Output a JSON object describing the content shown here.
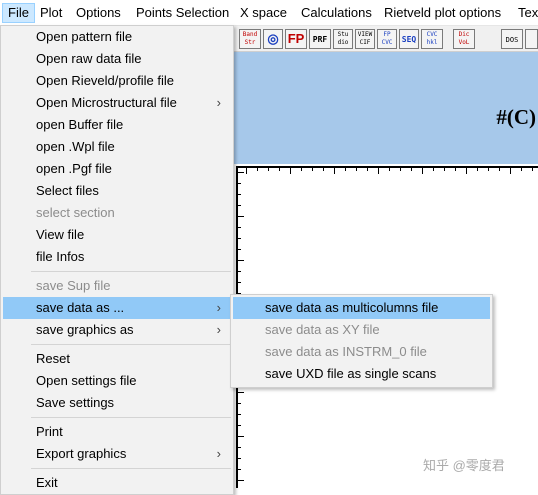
{
  "menubar": {
    "items": [
      "File",
      "Plot",
      "Options",
      "Points Selection",
      "X space",
      "Calculations",
      "Rietveld plot options",
      "Tex"
    ]
  },
  "toolbar": {
    "buttons": [
      {
        "icon": "band-structure-icon",
        "label": "Band Str"
      },
      {
        "icon": "target-icon",
        "label": "◎"
      },
      {
        "icon": "fullprof-icon",
        "label": "FP"
      },
      {
        "icon": "prf-icon",
        "label": "PRF"
      },
      {
        "icon": "studio-icon",
        "label": "Stu dio"
      },
      {
        "icon": "view-cif-icon",
        "label": "VIEW CIF"
      },
      {
        "icon": "fp-cvc-icon",
        "label": "FP CVC"
      },
      {
        "icon": "seq-icon",
        "label": "SEQ"
      },
      {
        "icon": "cvc-hkl-icon",
        "label": "CVC hkl"
      },
      {
        "icon": "dicvol-icon",
        "label": "Dic VoL"
      },
      {
        "icon": "dos-icon",
        "label": "DOS"
      },
      {
        "icon": "dos-grid-icon",
        "label": ""
      }
    ]
  },
  "plot": {
    "title_text": "#(C)"
  },
  "file_menu": {
    "items": [
      {
        "label": "Open pattern file",
        "enabled": true
      },
      {
        "label": "Open raw data file",
        "enabled": true
      },
      {
        "label": "Open Rieveld/profile file",
        "enabled": true
      },
      {
        "label": "Open Microstructural file",
        "enabled": true,
        "submenu": true
      },
      {
        "label": "open Buffer file",
        "enabled": true
      },
      {
        "label": "open .Wpl file",
        "enabled": true
      },
      {
        "label": "open .Pgf file",
        "enabled": true
      },
      {
        "label": "Select files",
        "enabled": true
      },
      {
        "label": "select section",
        "enabled": false
      },
      {
        "label": "View file",
        "enabled": true
      },
      {
        "label": "file Infos",
        "enabled": true
      },
      {
        "label": "save Sup file",
        "enabled": false
      },
      {
        "label": "save data as ...",
        "enabled": true,
        "submenu": true,
        "highlighted": true
      },
      {
        "label": "save graphics as",
        "enabled": true,
        "submenu": true
      },
      {
        "label": "Reset",
        "enabled": true
      },
      {
        "label": "Open settings file",
        "enabled": true
      },
      {
        "label": "Save settings",
        "enabled": true
      },
      {
        "label": "Print",
        "enabled": true
      },
      {
        "label": "Export graphics",
        "enabled": true,
        "submenu": true
      },
      {
        "label": "Exit",
        "enabled": true
      }
    ],
    "submenu_arrow": "›"
  },
  "save_data_submenu": {
    "items": [
      {
        "label": "save data as multicolumns file",
        "enabled": true,
        "highlighted": true
      },
      {
        "label": "save data as XY file",
        "enabled": false
      },
      {
        "label": "save data as INSTRM_0 file",
        "enabled": false
      },
      {
        "label": "save UXD file as single scans",
        "enabled": true
      }
    ]
  },
  "watermark": {
    "text": "知乎 @零度君"
  },
  "colors": {
    "menu_highlight": "#91c9f7",
    "menubar_active": "#cce8ff",
    "plot_band": "#a6c8ea",
    "disabled_text": "#8c8c8c"
  }
}
